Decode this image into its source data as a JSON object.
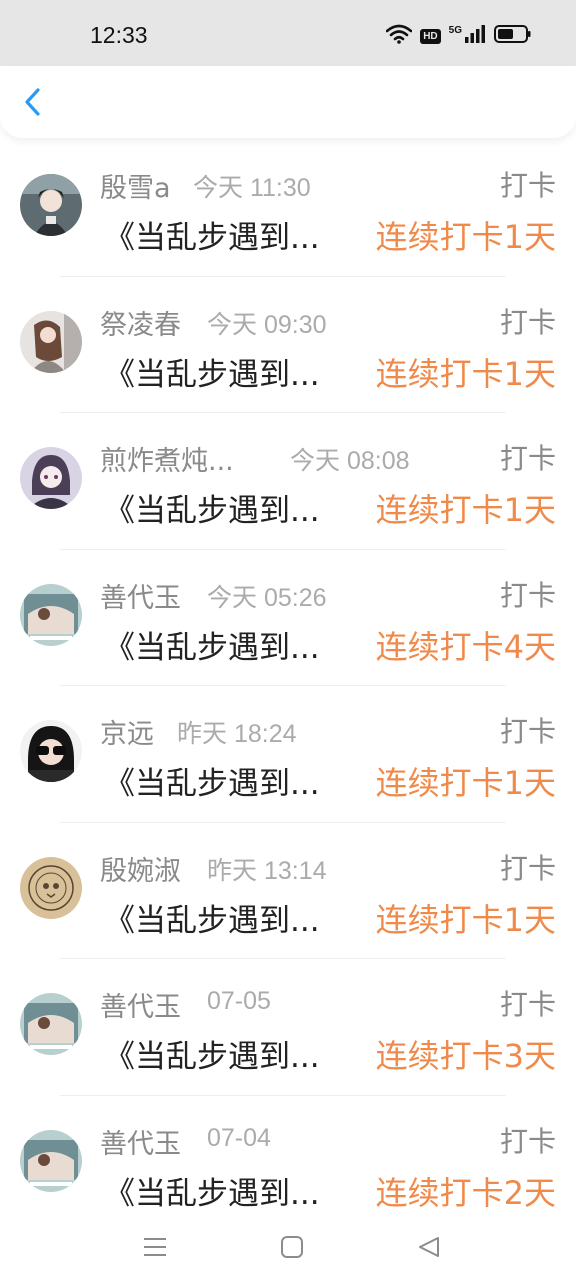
{
  "status_bar": {
    "time": "12:33",
    "hd": "HD",
    "network": "5G",
    "icons": [
      "wifi-icon",
      "signal-icon",
      "battery-icon"
    ]
  },
  "header": {
    "back_icon": "chevron-left-icon",
    "accent_color": "#2b9af3"
  },
  "colors": {
    "streak": "#f08a4b",
    "name": "#8a8a8a",
    "time": "#ababab"
  },
  "entries": [
    {
      "name": "殷雪a",
      "time": "今天 11:30",
      "type": "打卡",
      "title": "《当乱步遇到...",
      "streak": "连续打卡1天"
    },
    {
      "name": "祭凌春",
      "time": "今天 09:30",
      "type": "打卡",
      "title": "《当乱步遇到...",
      "streak": "连续打卡1天"
    },
    {
      "name": "煎炸煮炖...",
      "time": "今天 08:08",
      "type": "打卡",
      "title": "《当乱步遇到...",
      "streak": "连续打卡1天"
    },
    {
      "name": "善代玉",
      "time": "今天 05:26",
      "type": "打卡",
      "title": "《当乱步遇到...",
      "streak": "连续打卡4天"
    },
    {
      "name": "京远",
      "time": "昨天 18:24",
      "type": "打卡",
      "title": "《当乱步遇到...",
      "streak": "连续打卡1天"
    },
    {
      "name": "殷婉淑",
      "time": "昨天 13:14",
      "type": "打卡",
      "title": "《当乱步遇到...",
      "streak": "连续打卡1天"
    },
    {
      "name": "善代玉",
      "time": "07-05",
      "type": "打卡",
      "title": "《当乱步遇到...",
      "streak": "连续打卡3天"
    },
    {
      "name": "善代玉",
      "time": "07-04",
      "type": "打卡",
      "title": "《当乱步遇到...",
      "streak": "连续打卡2天"
    }
  ],
  "nav": [
    "menu-icon",
    "home-square-icon",
    "back-triangle-icon"
  ]
}
